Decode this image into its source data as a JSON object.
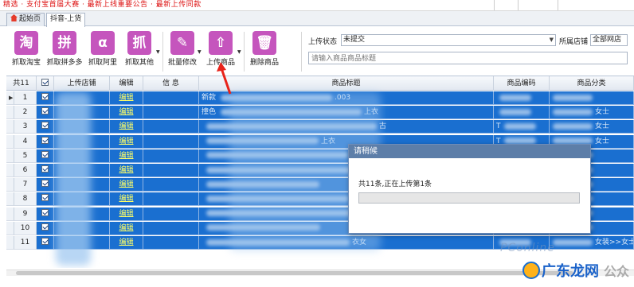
{
  "topbar": {
    "notice": "精选 · 支付宝首届大赛 · 最新上线重要公告 · 最新上传同款"
  },
  "tabs": [
    {
      "label": "起始页",
      "active": false
    },
    {
      "label": "抖音-上货",
      "active": true
    }
  ],
  "toolbar": {
    "buttons": [
      {
        "label": "抓取淘宝",
        "glyph": "淘",
        "color": "#c257b8"
      },
      {
        "label": "抓取拼多多",
        "glyph": "拼",
        "color": "#c257b8"
      },
      {
        "label": "抓取阿里",
        "glyph": "α",
        "color": "#c257b8"
      },
      {
        "label": "抓取其他",
        "glyph": "抓",
        "color": "#c257b8"
      },
      {
        "label": "批量修改",
        "glyph": "✎",
        "color": "#c257b8"
      },
      {
        "label": "上传商品",
        "glyph": "⇧",
        "color": "#c257b8"
      },
      {
        "label": "删除商品",
        "glyph": "🗑",
        "color": "#c257b8"
      }
    ]
  },
  "filters": {
    "upload_status_label": "上传状态",
    "upload_status_value": "未提交",
    "store_label": "所属店铺",
    "store_value": "全部网店",
    "search_placeholder": "请输入商品商品标题"
  },
  "grid": {
    "count_label": "共11",
    "columns": [
      "上传店铺",
      "编辑",
      "信 息",
      "商品标题",
      "商品编码",
      "商品分类"
    ],
    "edit_label": "编辑",
    "rows": [
      {
        "num": "1",
        "title": "新款",
        "title_tail": ".003",
        "code": "",
        "cat": ""
      },
      {
        "num": "2",
        "title": "撞色",
        "title_tail": "上衣",
        "code": "",
        "cat": "女士"
      },
      {
        "num": "3",
        "title": "",
        "title_tail": "古",
        "code": "T",
        "cat": "女士"
      },
      {
        "num": "4",
        "title": "",
        "title_tail": "上衣",
        "code": "T",
        "cat": "女士"
      },
      {
        "num": "5",
        "title": "",
        "title_tail": "",
        "code": "",
        "cat": ""
      },
      {
        "num": "6",
        "title": "",
        "title_tail": "",
        "code": "",
        "cat": ""
      },
      {
        "num": "7",
        "title": "",
        "title_tail": "",
        "code": "",
        "cat": ""
      },
      {
        "num": "8",
        "title": "",
        "title_tail": "",
        "code": "",
        "cat": ""
      },
      {
        "num": "9",
        "title": "",
        "title_tail": "",
        "code": "",
        "cat": ""
      },
      {
        "num": "10",
        "title": "",
        "title_tail": "",
        "code": "",
        "cat": ""
      },
      {
        "num": "11",
        "title": "",
        "title_tail": "衣女",
        "code": "",
        "cat": "女装>>女士"
      }
    ]
  },
  "dialog": {
    "title": "请稍候",
    "message": "共11条,正在上传第1条",
    "progress": 0
  },
  "watermark": {
    "pconline": "PConline",
    "brand": "广东龙网",
    "suffix": "公众"
  },
  "colors": {
    "selection": "#1a6fd0",
    "dialog_title": "#5d7ea8",
    "arrow": "#e8231a",
    "edit_link": "#ffff66"
  }
}
